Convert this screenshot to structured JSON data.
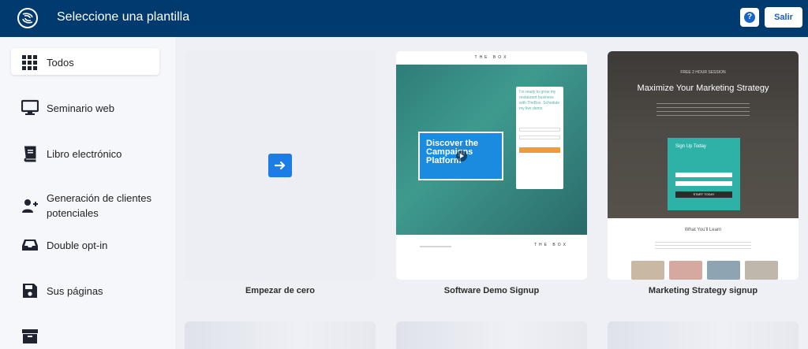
{
  "header": {
    "title": "Seleccione una plantilla",
    "help_label": "?",
    "exit_label": "Salir"
  },
  "sidebar": {
    "items": [
      {
        "label": "Todos",
        "icon": "grid-icon"
      },
      {
        "label": "Seminario web",
        "icon": "monitor-icon"
      },
      {
        "label": "Libro electrónico",
        "icon": "book-icon"
      },
      {
        "label": "Generación de clientes potenciales",
        "icon": "user-plus-icon"
      },
      {
        "label": "Double opt-in",
        "icon": "inbox-icon"
      },
      {
        "label": "Sus páginas",
        "icon": "save-icon"
      },
      {
        "label": "",
        "icon": "archive-icon"
      }
    ]
  },
  "templates": [
    {
      "label": "Empezar de cero"
    },
    {
      "label": "Software Demo Signup"
    },
    {
      "label": "Marketing Strategy signup"
    }
  ],
  "demo_thumb": {
    "nav": "THE BOX",
    "video_text": "Discover the Campaigns Platform",
    "form_heading": "I'm ready to grow my restaurant business with TheBox. Schedule my live demo"
  },
  "marketing_thumb": {
    "kicker": "FREE 2 HOUR SESSION",
    "title": "Maximize Your Marketing Strategy",
    "box_title": "Sign Up Today",
    "button": "START TODAY",
    "learn": "What You'll Learn"
  },
  "colors": {
    "header": "#003a6e",
    "accent": "#1c7ce8",
    "sidebar": "#f6f7fb",
    "content": "#eef0f6"
  }
}
